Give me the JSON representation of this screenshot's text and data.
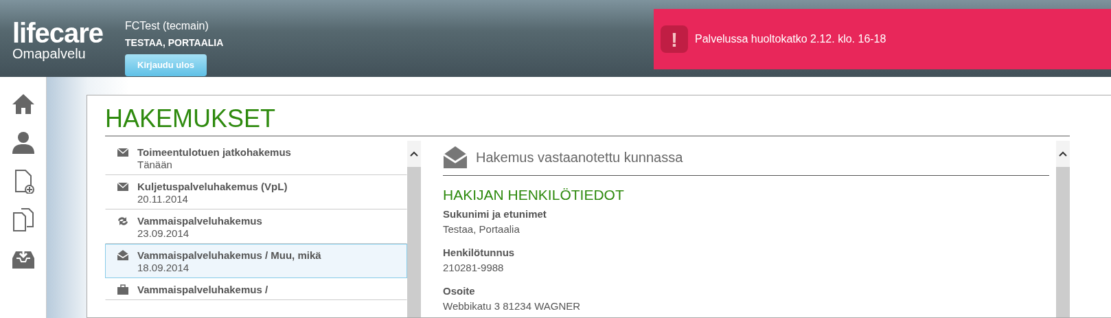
{
  "header": {
    "logo_title": "lifecare",
    "logo_subtitle": "Omapalvelu",
    "user_name": "FCTest (tecmain)",
    "user_fullname": "TESTAA, PORTAALIA",
    "logout_button": "Kirjaudu ulos"
  },
  "notice": {
    "icon": "!",
    "text": "Palvelussa huoltokatko 2.12. klo. 16-18"
  },
  "sidebar": {
    "items": [
      {
        "kind": "home"
      },
      {
        "kind": "person"
      },
      {
        "kind": "new-document"
      },
      {
        "kind": "documents"
      },
      {
        "kind": "inbox"
      }
    ]
  },
  "page_title": "HAKEMUKSET",
  "applications": [
    {
      "kind": "envelope",
      "title": "Toimeentulotuen jatkohakemus",
      "date": "Tänään",
      "selected": false
    },
    {
      "kind": "envelope",
      "title": "Kuljetuspalveluhakemus (VpL)",
      "date": "20.11.2014",
      "selected": false
    },
    {
      "kind": "exchange",
      "title": "Vammaispalveluhakemus",
      "date": "23.09.2014",
      "selected": false
    },
    {
      "kind": "open-envelope",
      "title": "Vammaispalveluhakemus / Muu, mikä",
      "date": "18.09.2014",
      "selected": true
    },
    {
      "kind": "case",
      "title": "Vammaispalveluhakemus /",
      "selected": false
    }
  ],
  "detail": {
    "status": "Hakemus vastaanotettu kunnassa",
    "section_title": "HAKIJAN HENKILÖTIEDOT",
    "fields": [
      {
        "label": "Sukunimi ja etunimet",
        "value": "Testaa, Portaalia"
      },
      {
        "label": "Henkilötunnus",
        "value": "210281-9988"
      },
      {
        "label": "Osoite",
        "value": "Webbikatu 3 81234 WAGNER"
      }
    ]
  }
}
